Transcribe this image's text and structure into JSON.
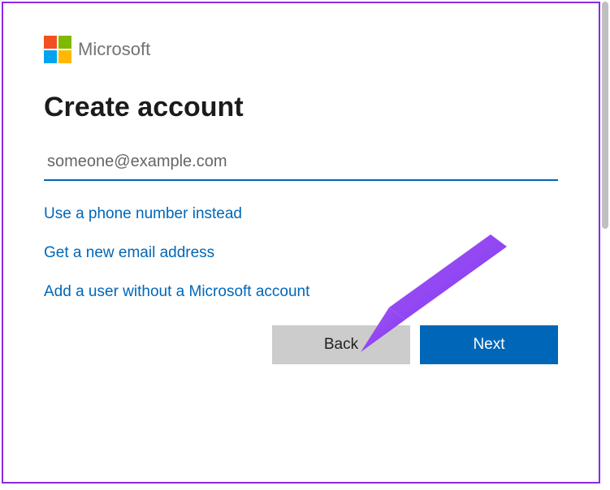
{
  "brand": {
    "name": "Microsoft"
  },
  "heading": "Create account",
  "email": {
    "placeholder": "someone@example.com"
  },
  "links": {
    "phone": "Use a phone number instead",
    "newEmail": "Get a new email address",
    "noAccount": "Add a user without a Microsoft account"
  },
  "buttons": {
    "back": "Back",
    "next": "Next"
  }
}
